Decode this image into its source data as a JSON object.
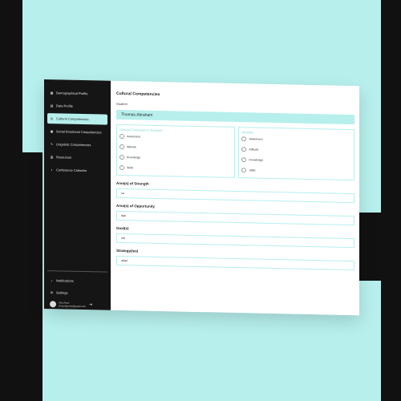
{
  "sidebar": {
    "items": [
      {
        "label": "Demographical Profile",
        "icon": "grid-icon"
      },
      {
        "label": "Data Profile",
        "icon": "document-icon"
      },
      {
        "label": "Cultural Competencies",
        "icon": "globe-icon",
        "active": true
      },
      {
        "label": "Social Emotional Competencies",
        "icon": "heart-icon"
      },
      {
        "label": "Linguistic Competencies",
        "icon": "translate-icon"
      },
      {
        "label": "Resources",
        "icon": "chart-icon"
      },
      {
        "label": "Conference Calendar",
        "icon": "calendar-icon"
      }
    ],
    "bottom": [
      {
        "label": "Notifications",
        "icon": "bell-icon"
      },
      {
        "label": "Settings",
        "icon": "gear-icon"
      }
    ],
    "user": {
      "name": "Inna Alam",
      "email": "vincentgreen@gmail.com"
    }
  },
  "main": {
    "title": "Cultural Competencies",
    "student_label": "Student",
    "student_name": "Thomas Abraham",
    "box_left": {
      "title": "Cultural Competence Analysis",
      "options": [
        "Awareness",
        "Attitude",
        "Knowledge",
        "Skills"
      ]
    },
    "box_right": {
      "title": "Analysis",
      "options": [
        "Awareness",
        "Attitude",
        "Knowledge",
        "Skills"
      ]
    },
    "fields": [
      {
        "label": "Area(s) of Strength",
        "value": "ca"
      },
      {
        "label": "Area(s) of Opportunity",
        "value": "dqh"
      },
      {
        "label": "Goal(s)",
        "value": "sfd"
      },
      {
        "label": "Strategy(ies)",
        "value": "adqd"
      }
    ]
  },
  "colors": {
    "accent": "#b6efec",
    "sidebar_bg": "#151515"
  }
}
